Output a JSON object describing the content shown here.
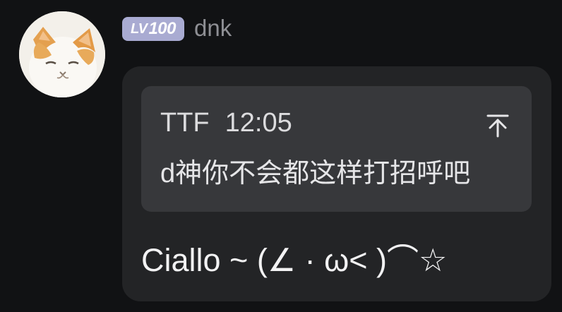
{
  "message": {
    "sender": {
      "level_badge_prefix": "LV",
      "level_badge_value": "100",
      "username": "dnk",
      "avatar_icon": "cat-avatar"
    },
    "reply": {
      "author": "TTF",
      "time": "12:05",
      "text": "d神你不会都这样打招呼吧",
      "jump_icon": "arrow-up-to-top-icon"
    },
    "text": "Ciallo ~ (∠ · ω< )⌒☆"
  },
  "colors": {
    "background": "#111214",
    "bubble": "#232426",
    "reply_card": "#37383b",
    "badge": "#a9abd2",
    "username": "#8e8f94"
  }
}
